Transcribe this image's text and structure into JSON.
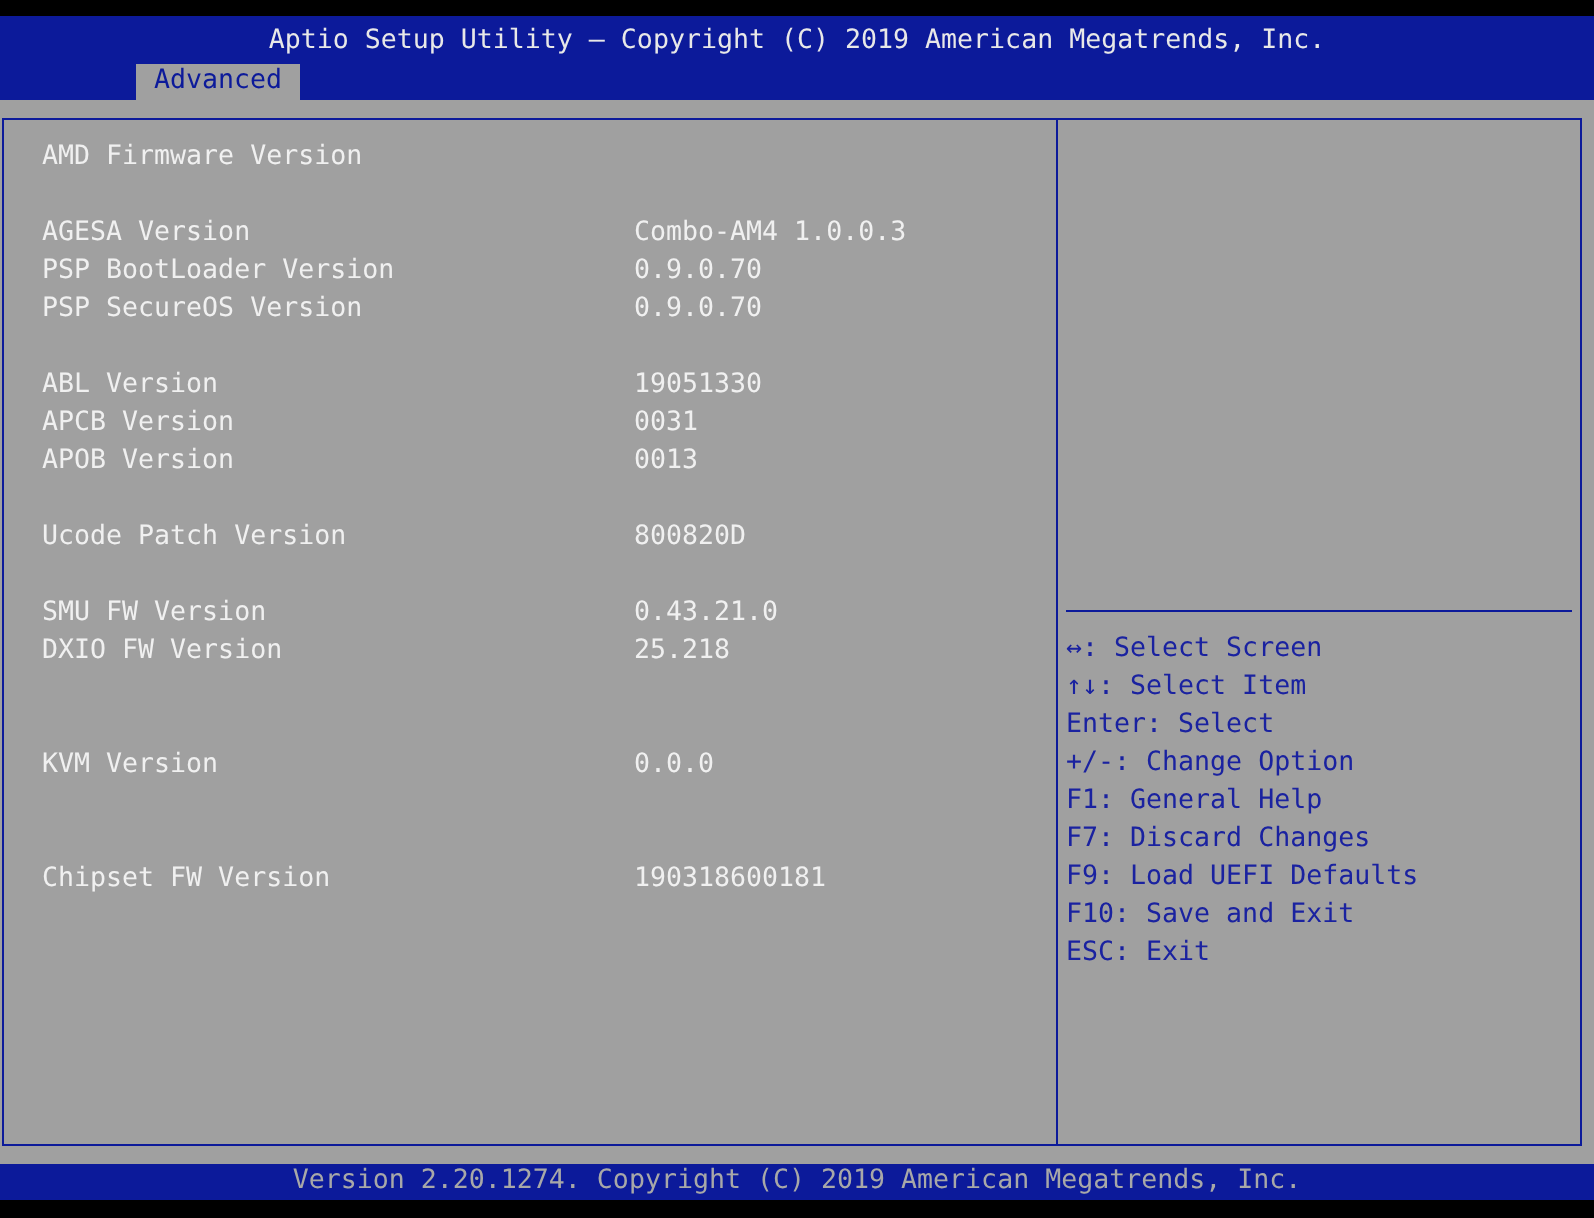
{
  "window": {
    "title": "Aptio Setup Utility – Copyright (C) 2019 American Megatrends, Inc."
  },
  "tabs": [
    {
      "label": "Advanced",
      "selected": true
    }
  ],
  "rows": [
    {
      "kind": "title",
      "label": "AMD Firmware Version"
    },
    {
      "kind": "blank"
    },
    {
      "kind": "item",
      "label": "AGESA Version",
      "value": "Combo-AM4 1.0.0.3"
    },
    {
      "kind": "item",
      "label": "PSP BootLoader Version",
      "value": "0.9.0.70"
    },
    {
      "kind": "item",
      "label": "PSP SecureOS Version",
      "value": "0.9.0.70"
    },
    {
      "kind": "blank"
    },
    {
      "kind": "item",
      "label": "ABL Version",
      "value": "19051330"
    },
    {
      "kind": "item",
      "label": "APCB Version",
      "value": "0031"
    },
    {
      "kind": "item",
      "label": "APOB Version",
      "value": "0013"
    },
    {
      "kind": "blank"
    },
    {
      "kind": "item",
      "label": "Ucode Patch Version",
      "value": "800820D"
    },
    {
      "kind": "blank"
    },
    {
      "kind": "item",
      "label": "SMU FW Version",
      "value": "0.43.21.0"
    },
    {
      "kind": "item",
      "label": "DXIO FW Version",
      "value": "25.218"
    },
    {
      "kind": "blank"
    },
    {
      "kind": "blank"
    },
    {
      "kind": "item",
      "label": "KVM Version",
      "value": "0.0.0"
    },
    {
      "kind": "blank"
    },
    {
      "kind": "blank"
    },
    {
      "kind": "item",
      "label": "Chipset FW Version",
      "value": "190318600181"
    }
  ],
  "help": [
    "↔: Select Screen",
    "↑↓: Select Item",
    "Enter: Select",
    "+/-: Change Option",
    "F1: General Help",
    "F7: Discard Changes",
    "F9: Load UEFI Defaults",
    "F10: Save and Exit",
    "ESC: Exit"
  ],
  "status_bar": "Version 2.20.1274. Copyright (C) 2019 American Megatrends, Inc."
}
